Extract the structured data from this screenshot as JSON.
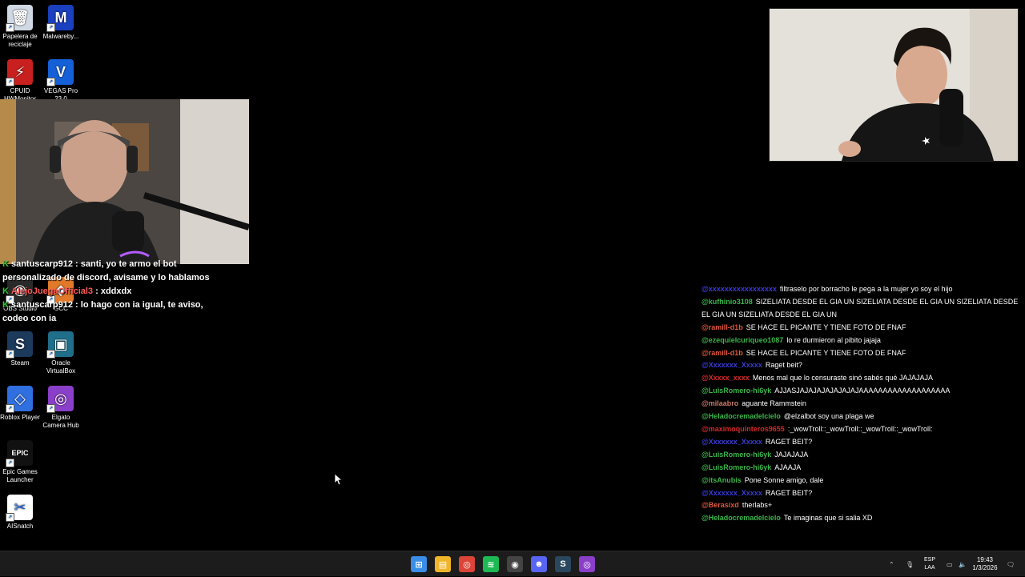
{
  "desktop_icons": [
    {
      "name": "recycle-bin-icon",
      "label": "Papelera de reciclaje",
      "color": "#cfd8e3",
      "glyph": "🗑"
    },
    {
      "name": "malwarebytes-icon",
      "label": "Malwareby...",
      "color": "#1a3fbf",
      "glyph": "M"
    },
    {
      "name": "hwmonitor-icon",
      "label": "CPUID HWMonitor",
      "color": "#c8201e",
      "glyph": "⚡"
    },
    {
      "name": "vegas-pro-icon",
      "label": "VEGAS Pro 23.0",
      "color": "#1560d6",
      "glyph": "V"
    },
    {
      "name": "obs-studio-icon",
      "label": "OBS Studio",
      "color": "#2a2a2a",
      "glyph": "◉"
    },
    {
      "name": "gcc-icon",
      "label": "GCC",
      "color": "#e07a2a",
      "glyph": "◆"
    },
    {
      "name": "steam-icon",
      "label": "Steam",
      "color": "#1b3a5c",
      "glyph": "S"
    },
    {
      "name": "virtualbox-icon",
      "label": "Oracle VirtualBox",
      "color": "#1f6f8b",
      "glyph": "▣"
    },
    {
      "name": "roblox-icon",
      "label": "Roblox Player",
      "color": "#2f6fe0",
      "glyph": "◇"
    },
    {
      "name": "camera-hub-icon",
      "label": "Elgato Camera Hub",
      "color": "#8a3fc9",
      "glyph": "◎"
    },
    {
      "name": "epic-games-icon",
      "label": "Epic Games Launcher",
      "color": "#111111",
      "glyph": "EPIC"
    },
    {
      "name": "aisnatch-icon",
      "label": "AISnatch",
      "color": "#ffffff",
      "glyph": "✂"
    }
  ],
  "left_chat": [
    {
      "user": "santuscarp912",
      "user_color": "#ffffff",
      "text": ": santi, yo te armo el bot personalizado de discord, avisame y lo hablamos",
      "badge": "K"
    },
    {
      "user": "AlejoJuegaOfficial3",
      "user_color": "#ff5a5a",
      "text": ": xddxdx",
      "badge": "K"
    },
    {
      "user": "santuscarp912",
      "user_color": "#ffffff",
      "text": ": lo hago con ia igual, te aviso, codeo con ia",
      "badge": "K"
    }
  ],
  "right_chat": [
    {
      "user": "@xxxxxxxxxxxxxxxxx",
      "user_color": "#3b3bdb",
      "text": "filtraselo por borracho le pega a la mujer yo soy el hijo"
    },
    {
      "user": "@kufhinio3108",
      "user_color": "#3bb54a",
      "text": "SIZELIATA DESDE EL GIA UN SIZELIATA DESDE EL GIA UN SIZELIATA DESDE EL GIA UN SIZELIATA DESDE EL GIA UN"
    },
    {
      "user": "@ramill-d1b",
      "user_color": "#e0563a",
      "text": "SE HACE EL PICANTE Y TIENE FOTO DE FNAF"
    },
    {
      "user": "@ezequielcuriqueo1087",
      "user_color": "#3bb54a",
      "text": "lo re durmieron al pibito jajaja"
    },
    {
      "user": "@ramill-d1b",
      "user_color": "#e0563a",
      "text": "SE HACE EL PICANTE Y TIENE FOTO DE FNAF"
    },
    {
      "user": "@Xxxxxxx_Xxxxx",
      "user_color": "#3b3bdb",
      "text": "Raget beit?"
    },
    {
      "user": "@Xxxxx_xxxx",
      "user_color": "#d42a2a",
      "text": "Menos mal que lo censuraste sinó sabés qué JAJAJAJA"
    },
    {
      "user": "@LuisRomero-hi6yk",
      "user_color": "#3bb54a",
      "text": "AJJASJAJAJAJAJAJAJAJAAAAAAAAAAAAAAAAAAA"
    },
    {
      "user": "@milaabro",
      "user_color": "#c87a6a",
      "text": "aguante Rammstein"
    },
    {
      "user": "@Heladocremadelcielo",
      "user_color": "#3bb54a",
      "text": "@elzalbot soy una plaga we"
    },
    {
      "user": "@maximoquinteros9655",
      "user_color": "#d42a2a",
      "text": ":_wowTroll::_wowTroll::_wowTroll::_wowTroll:"
    },
    {
      "user": "@Xxxxxxx_Xxxxx",
      "user_color": "#3b3bdb",
      "text": "RAGET BEIT?"
    },
    {
      "user": "@LuisRomero-hi6yk",
      "user_color": "#3bb54a",
      "text": "JAJAJAJA"
    },
    {
      "user": "@LuisRomero-hi6yk",
      "user_color": "#3bb54a",
      "text": "AJAAJA"
    },
    {
      "user": "@itsAnubis",
      "user_color": "#3bb54a",
      "text": "Pone Sonne amigo, dale"
    },
    {
      "user": "@Xxxxxxx_Xxxxx",
      "user_color": "#3b3bdb",
      "text": "RAGET BEIT?"
    },
    {
      "user": "@Berasixd",
      "user_color": "#e0563a",
      "text": "therlabs+"
    },
    {
      "user": "@Heladocremadelcielo",
      "user_color": "#3bb54a",
      "text": "Te imaginas que si salia XD"
    }
  ],
  "taskbar": {
    "apps": [
      {
        "name": "start-button",
        "color": "#3a8ee8",
        "glyph": "⊞"
      },
      {
        "name": "file-explorer-icon",
        "color": "#f0b429",
        "glyph": "▤"
      },
      {
        "name": "chrome-icon",
        "color": "#db4437",
        "glyph": "◎"
      },
      {
        "name": "spotify-icon",
        "color": "#1db954",
        "glyph": "≋"
      },
      {
        "name": "obs-taskbar-icon",
        "color": "#444444",
        "glyph": "◉"
      },
      {
        "name": "discord-icon",
        "color": "#5865f2",
        "glyph": "☻"
      },
      {
        "name": "steam-taskbar-icon",
        "color": "#2a475e",
        "glyph": "S"
      },
      {
        "name": "camera-hub-taskbar-icon",
        "color": "#8a3fc9",
        "glyph": "◎"
      }
    ],
    "lang_top": "ESP",
    "lang_bottom": "LAA",
    "time": "19:43",
    "date": "1/3/2026"
  }
}
